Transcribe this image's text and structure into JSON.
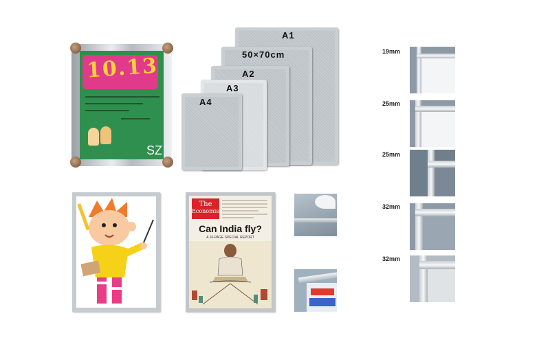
{
  "poster": {
    "date_text": "10.13",
    "corner_text": "SZ"
  },
  "size_frames": {
    "labels": [
      "A1",
      "50×70cm",
      "A2",
      "A3",
      "A4"
    ]
  },
  "profiles": [
    {
      "label": "19mm"
    },
    {
      "label": "25mm"
    },
    {
      "label": "25mm"
    },
    {
      "label": "32mm"
    },
    {
      "label": "32mm"
    }
  ],
  "magazine": {
    "logo_line1": "The",
    "logo_line2": "Economist",
    "headline": "Can India fly?",
    "subline": "A 16-PAGE SPECIAL REPORT"
  },
  "colors": {
    "frame_silver": "#c9ced3",
    "poster_green": "#2f8f4e",
    "poster_pink": "#e23a8a",
    "economist_red": "#d8232a"
  }
}
